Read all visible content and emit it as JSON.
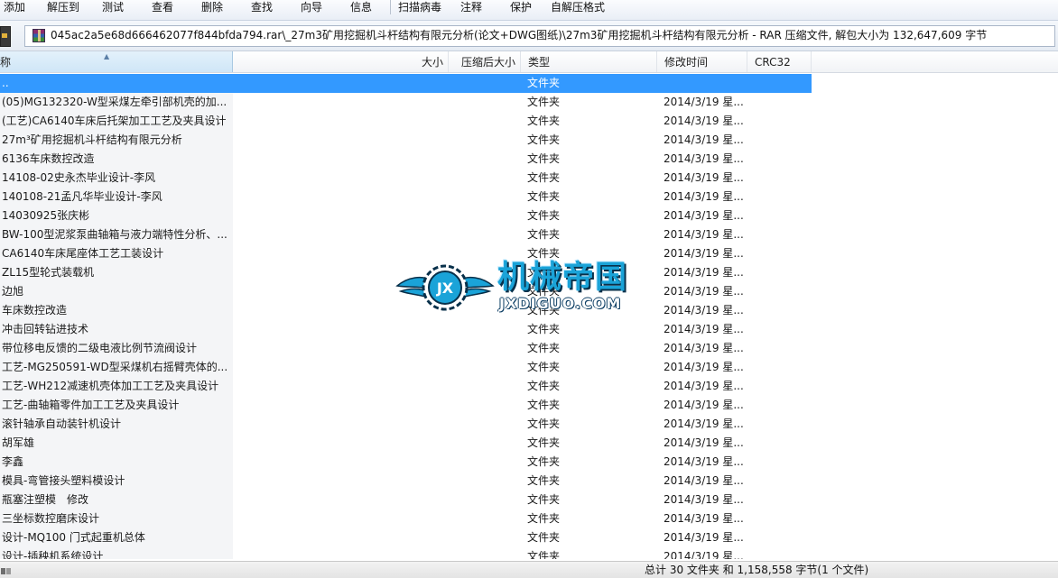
{
  "toolbar": {
    "items": [
      "添加",
      "解压到",
      "测试",
      "查看",
      "删除",
      "查找",
      "向导",
      "信息",
      "扫描病毒",
      "注释",
      "保护",
      "自解压格式"
    ]
  },
  "address_bar": {
    "path": "045ac2a5e68d666462077f844bfda794.rar\\_27m3矿用挖掘机斗杆结构有限元分析(论文+DWG图纸)\\27m3矿用挖掘机斗杆结构有限元分析 - RAR 压缩文件, 解包大小为 132,647,609 字节"
  },
  "columns": {
    "name": "称",
    "size": "大小",
    "packed": "压缩后大小",
    "type": "类型",
    "modified": "修改时间",
    "crc": "CRC32"
  },
  "rows": [
    {
      "name": "..",
      "type": "文件夹",
      "modified": ""
    },
    {
      "name": "(05)MG132320-W型采煤左牵引部机壳的加...",
      "type": "文件夹",
      "modified": "2014/3/19 星..."
    },
    {
      "name": "(工艺)CA6140车床后托架加工工艺及夹具设计",
      "type": "文件夹",
      "modified": "2014/3/19 星..."
    },
    {
      "name": "27m³矿用挖掘机斗杆结构有限元分析",
      "type": "文件夹",
      "modified": "2014/3/19 星..."
    },
    {
      "name": "6136车床数控改造",
      "type": "文件夹",
      "modified": "2014/3/19 星..."
    },
    {
      "name": "14108-02史永杰毕业设计-李风",
      "type": "文件夹",
      "modified": "2014/3/19 星..."
    },
    {
      "name": "140108-21孟凡华毕业设计-李风",
      "type": "文件夹",
      "modified": "2014/3/19 星..."
    },
    {
      "name": "14030925张庆彬",
      "type": "文件夹",
      "modified": "2014/3/19 星..."
    },
    {
      "name": "BW-100型泥浆泵曲轴箱与液力端特性分析、...",
      "type": "文件夹",
      "modified": "2014/3/19 星..."
    },
    {
      "name": "CA6140车床尾座体工艺工装设计",
      "type": "文件夹",
      "modified": "2014/3/19 星..."
    },
    {
      "name": "ZL15型轮式装载机",
      "type": "文件夹",
      "modified": "2014/3/19 星..."
    },
    {
      "name": "边旭",
      "type": "文件夹",
      "modified": "2014/3/19 星..."
    },
    {
      "name": "车床数控改造",
      "type": "文件夹",
      "modified": "2014/3/19 星..."
    },
    {
      "name": "冲击回转钻进技术",
      "type": "文件夹",
      "modified": "2014/3/19 星..."
    },
    {
      "name": "带位移电反馈的二级电液比例节流阀设计",
      "type": "文件夹",
      "modified": "2014/3/19 星..."
    },
    {
      "name": "工艺-MG250591-WD型采煤机右摇臂壳体的...",
      "type": "文件夹",
      "modified": "2014/3/19 星..."
    },
    {
      "name": "工艺-WH212减速机壳体加工工艺及夹具设计",
      "type": "文件夹",
      "modified": "2014/3/19 星..."
    },
    {
      "name": "工艺-曲轴箱零件加工工艺及夹具设计",
      "type": "文件夹",
      "modified": "2014/3/19 星..."
    },
    {
      "name": "滚针轴承自动装针机设计",
      "type": "文件夹",
      "modified": "2014/3/19 星..."
    },
    {
      "name": "胡军雄",
      "type": "文件夹",
      "modified": "2014/3/19 星..."
    },
    {
      "name": "李鑫",
      "type": "文件夹",
      "modified": "2014/3/19 星..."
    },
    {
      "name": "模具-弯管接头塑料模设计",
      "type": "文件夹",
      "modified": "2014/3/19 星..."
    },
    {
      "name": "瓶塞注塑模　修改",
      "type": "文件夹",
      "modified": "2014/3/19 星..."
    },
    {
      "name": "三坐标数控磨床设计",
      "type": "文件夹",
      "modified": "2014/3/19 星..."
    },
    {
      "name": "设计-MQ100 门式起重机总体",
      "type": "文件夹",
      "modified": "2014/3/19 星..."
    },
    {
      "name": "设计-插秧机系统设计",
      "type": "文件夹",
      "modified": "2014/3/19 星..."
    }
  ],
  "selected_row": 0,
  "status": {
    "text": "总计 30 文件夹 和 1,158,558 字节(1 个文件)"
  },
  "watermark": {
    "cn": "机械帝国",
    "en": "JXDIGUO.COM",
    "emblem": "JX"
  },
  "colors": {
    "selection": "#3399ff",
    "watermark_blue": "#1aa3d8"
  }
}
